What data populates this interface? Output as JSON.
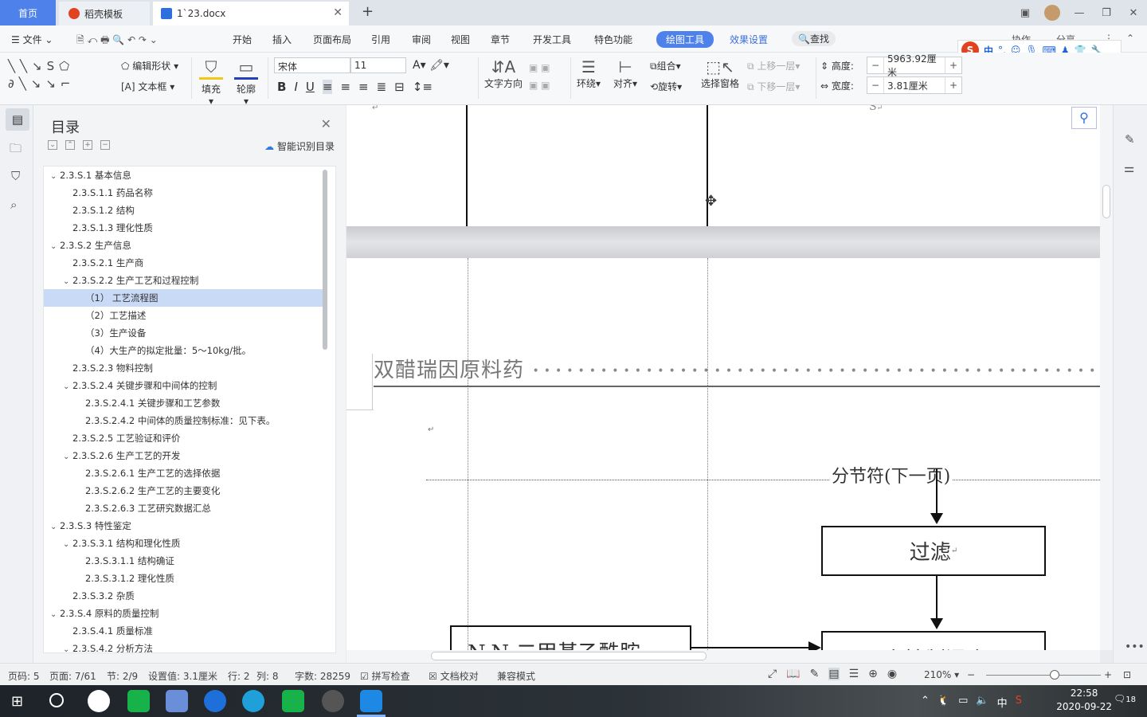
{
  "tabs": {
    "home": "首页",
    "template": "稻壳模板",
    "doc": "1`23.docx",
    "plus": "+"
  },
  "menu": {
    "file": "文件",
    "items": [
      "开始",
      "插入",
      "页面布局",
      "引用",
      "审阅",
      "视图",
      "章节",
      "开发工具",
      "特色功能"
    ],
    "drawing_tools": "绘图工具",
    "effects": "效果设置",
    "search": "查找",
    "collab": "协作",
    "share": "分享"
  },
  "ribbon": {
    "edit_shape": "编辑形状",
    "text_box": "文本框",
    "fill": "填充",
    "outline": "轮廓",
    "font": "宋体",
    "size": "11",
    "text_direction": "文字方向",
    "wrap": "环绕",
    "align": "对齐",
    "group": "组合",
    "rotate": "旋转",
    "selection_pane": "选择窗格",
    "bring_forward": "上移一层",
    "send_backward": "下移一层",
    "height_label": "高度:",
    "height_value": "5963.92厘米",
    "width_label": "宽度:",
    "width_value": "3.81厘米"
  },
  "ime": {
    "s": "S",
    "zh": "中",
    "punct": "°,"
  },
  "toc": {
    "title": "目录",
    "smart": "智能识别目录",
    "items": [
      {
        "chev": "v",
        "label": "2.3.S.1  基本信息",
        "indent": 0
      },
      {
        "chev": "",
        "label": "2.3.S.1.1 药品名称",
        "indent": 1
      },
      {
        "chev": "",
        "label": "2.3.S.1.2  结构",
        "indent": 1
      },
      {
        "chev": "",
        "label": "2.3.S.1.3  理化性质",
        "indent": 1
      },
      {
        "chev": "v",
        "label": "2.3.S.2  生产信息",
        "indent": 0
      },
      {
        "chev": "",
        "label": "2.3.S.2.1 生产商",
        "indent": 1
      },
      {
        "chev": "v",
        "label": "2.3.S.2.2  生产工艺和过程控制",
        "indent": 1
      },
      {
        "chev": "",
        "label": "（1）  工艺流程图",
        "indent": 2,
        "active": true
      },
      {
        "chev": "",
        "label": "（2）工艺描述",
        "indent": 2
      },
      {
        "chev": "",
        "label": "（3）生产设备",
        "indent": 2
      },
      {
        "chev": "",
        "label": "（4）大生产的拟定批量：5～10kg/批。",
        "indent": 2
      },
      {
        "chev": "",
        "label": "2.3.S.2.3  物料控制",
        "indent": 1
      },
      {
        "chev": "v",
        "label": "2.3.S.2.4 关键步骤和中间体的控制",
        "indent": 1
      },
      {
        "chev": "",
        "label": "2.3.S.2.4.1 关键步骤和工艺参数",
        "indent": 2
      },
      {
        "chev": "",
        "label": "2.3.S.2.4.2 中间体的质量控制标准：见下表。",
        "indent": 2
      },
      {
        "chev": "",
        "label": "2.3.S.2.5  工艺验证和评价",
        "indent": 1
      },
      {
        "chev": "v",
        "label": "2.3.S.2.6  生产工艺的开发",
        "indent": 1
      },
      {
        "chev": "",
        "label": "2.3.S.2.6.1  生产工艺的选择依据",
        "indent": 2
      },
      {
        "chev": "",
        "label": "2.3.S.2.6.2  生产工艺的主要变化",
        "indent": 2
      },
      {
        "chev": "",
        "label": "2.3.S.2.6.3 工艺研究数据汇总",
        "indent": 2
      },
      {
        "chev": "v",
        "label": "2.3.S.3  特性鉴定",
        "indent": 0
      },
      {
        "chev": "v",
        "label": "2.3.S.3.1  结构和理化性质",
        "indent": 1
      },
      {
        "chev": "",
        "label": "2.3.S.3.1.1 结构确证",
        "indent": 2
      },
      {
        "chev": "",
        "label": "2.3.S.3.1.2 理化性质",
        "indent": 2
      },
      {
        "chev": "",
        "label": "2.3.S.3.2  杂质",
        "indent": 1
      },
      {
        "chev": "v",
        "label": "2.3.S.4 原料的质量控制",
        "indent": 0
      },
      {
        "chev": "",
        "label": "2.3.S.4.1 质量标准",
        "indent": 1
      },
      {
        "chev": "v",
        "label": "2.3.S.4.2  分析方法",
        "indent": 1
      }
    ]
  },
  "document": {
    "header_text": "双醋瑞因原料药",
    "section_break": "分节符(下一页)",
    "box_filter": "过滤",
    "box_left": "N,N-二甲基乙酰胺",
    "box_bottom": "二次精制混合",
    "mark_top": "S",
    "para_mark": "↵"
  },
  "status": {
    "page_no": "页码: 5",
    "page": "页面: 7/61",
    "section": "节: 2/9",
    "setting": "设置值: 3.1厘米",
    "row": "行: 2",
    "col": "列: 8",
    "words": "字数: 28259",
    "spell": "拼写检查",
    "proof": "文档校对",
    "compat": "兼容模式",
    "zoom": "210%"
  },
  "taskbar": {
    "time": "22:58",
    "date": "2020-09-22",
    "ime": "中",
    "notify": "18"
  },
  "colors": {
    "accent": "#4e82ea",
    "tab_active": "#ffffff",
    "titlebar": "#dfe3ea",
    "toc_active": "#c9daf7",
    "sogou": "#e2431f",
    "wps_taskbar": "#1e88e5"
  }
}
